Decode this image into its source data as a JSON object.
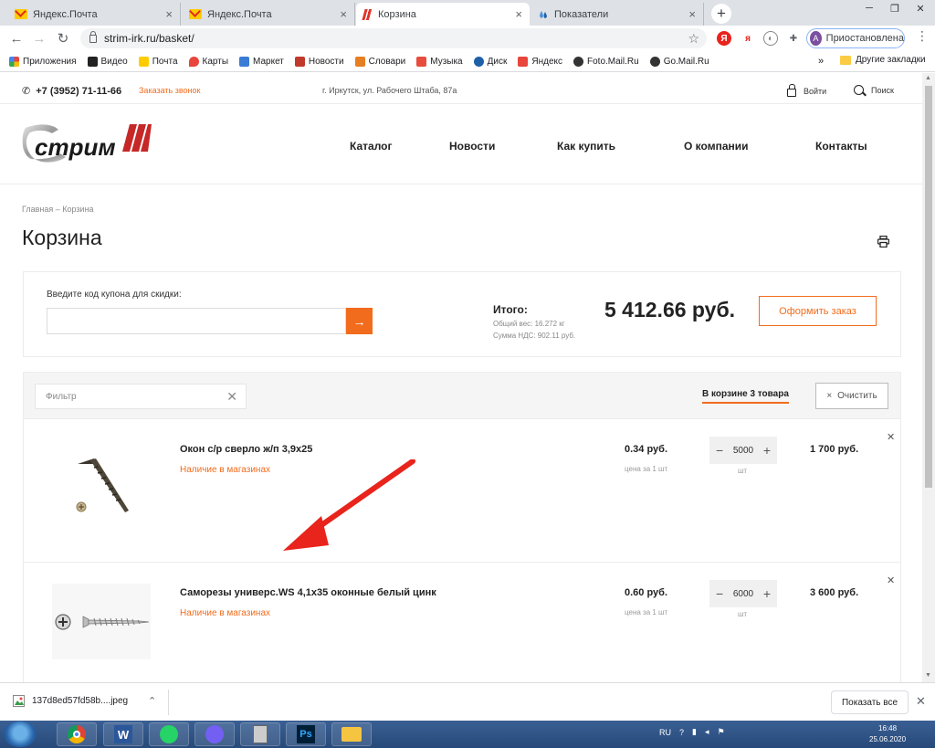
{
  "browser": {
    "tabs": [
      {
        "title": "Яндекс.Почта",
        "icon": "yandex-mail-icon"
      },
      {
        "title": "Яндекс.Почта",
        "icon": "yandex-mail-icon"
      },
      {
        "title": "Корзина",
        "icon": "strim-favicon"
      },
      {
        "title": "Показатели",
        "icon": "drop-icon"
      }
    ],
    "url": "strim-irk.ru/basket/",
    "profile_initial": "А",
    "profile_label": "Приостановлена",
    "bookmarks": [
      {
        "label": "Приложения",
        "icon": "apps-grid-icon",
        "color": "#e8453c"
      },
      {
        "label": "Видео",
        "icon": "video-icon",
        "color": "#333333"
      },
      {
        "label": "Почта",
        "icon": "mail-icon",
        "color": "#ffcc00"
      },
      {
        "label": "Карты",
        "icon": "maps-icon",
        "color": "#e8453c"
      },
      {
        "label": "Маркет",
        "icon": "cart-icon",
        "color": "#3a7bd5"
      },
      {
        "label": "Новости",
        "icon": "news-icon",
        "color": "#c0392b"
      },
      {
        "label": "Словари",
        "icon": "dictionary-icon",
        "color": "#e67e22"
      },
      {
        "label": "Музыка",
        "icon": "music-icon",
        "color": "#e74c3c"
      },
      {
        "label": "Диск",
        "icon": "disk-icon",
        "color": "#1e5fa8"
      },
      {
        "label": "Яндекс",
        "icon": "yandex-icon",
        "color": "#e8453c"
      },
      {
        "label": "Foto.Mail.Ru",
        "icon": "photo-icon",
        "color": "#333333"
      },
      {
        "label": "Go.Mail.Ru",
        "icon": "go-mail-icon",
        "color": "#333333"
      }
    ],
    "bookmarks_more": "»",
    "other_bookmarks": "Другие закладки"
  },
  "site": {
    "phone": "+7 (3952) 71-11-66",
    "callback": "Заказать звонок",
    "address": "г. Иркутск, ул. Рабочего Штаба, 87а",
    "login": "Войти",
    "search": "Поиск",
    "logo_text": "стрим",
    "nav": [
      "Каталог",
      "Новости",
      "Как купить",
      "О компании",
      "Контакты"
    ],
    "breadcrumb": "Главная – Корзина",
    "title": "Корзина",
    "coupon_label": "Введите код купона для скидки:",
    "coupon_value": "",
    "summary": {
      "label": "Итого:",
      "weight": "Общий вес: 16.272 кг",
      "vat": "Сумма НДС: 902.11 руб.",
      "total": "5 412.66 руб.",
      "order_button": "Оформить заказ"
    },
    "filter_placeholder": "Фильтр",
    "count_label": "В корзине 3 товара",
    "clear_label": "Очистить",
    "items": [
      {
        "name": "Окон с/р сверло ж/п 3,9х25",
        "availability": "Наличие в магазинах",
        "price": "0.34 руб.",
        "price_unit": "цена за 1 шт",
        "qty": "5000",
        "qty_unit": "шт",
        "sum": "1 700 руб."
      },
      {
        "name": "Саморезы универс.WS 4,1х35 оконные белый цинк",
        "availability": "Наличие в магазинах",
        "price": "0.60 руб.",
        "price_unit": "цена за 1 шт",
        "qty": "6000",
        "qty_unit": "шт",
        "sum": "3 600 руб."
      }
    ]
  },
  "downloads": {
    "file": "137d8ed57fd58b....jpeg",
    "show_all": "Показать все"
  },
  "taskbar": {
    "lang": "RU",
    "time": "16:48",
    "date": "25.06.2020"
  },
  "colors": {
    "accent": "#f26c1d",
    "arrow": "#e8241c"
  }
}
